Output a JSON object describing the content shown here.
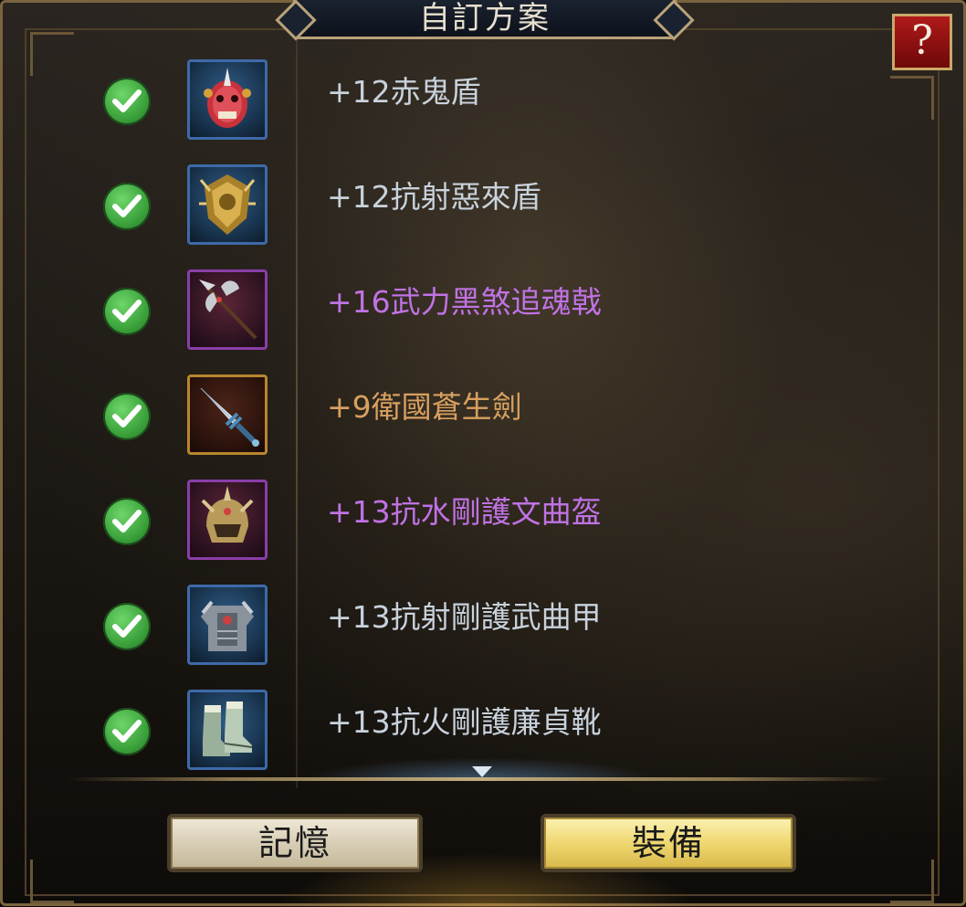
{
  "title": "自訂方案",
  "help_label": "?",
  "items": [
    {
      "name": "+12赤鬼盾",
      "icon": "red-demon-shield-icon",
      "rarity_color": "#3e6aa8",
      "text_color": "#c8d2dc"
    },
    {
      "name": "+12抗射惡來盾",
      "icon": "golden-shield-icon",
      "rarity_color": "#3e6aa8",
      "text_color": "#c8d2dc"
    },
    {
      "name": "+16武力黑煞追魂戟",
      "icon": "halberd-icon",
      "rarity_color": "#8a3ea8",
      "text_color": "#c072e4"
    },
    {
      "name": "+9衛國蒼生劍",
      "icon": "sword-icon",
      "rarity_color": "#b8862e",
      "text_color": "#d8a060"
    },
    {
      "name": "+13抗水剛護文曲盔",
      "icon": "helmet-icon",
      "rarity_color": "#8a3ea8",
      "text_color": "#c072e4"
    },
    {
      "name": "+13抗射剛護武曲甲",
      "icon": "armor-icon",
      "rarity_color": "#3e6aa8",
      "text_color": "#c8d2dc"
    },
    {
      "name": "+13抗火剛護廉貞靴",
      "icon": "boots-icon",
      "rarity_color": "#3e6aa8",
      "text_color": "#c8d2dc"
    }
  ],
  "buttons": {
    "memory_label": "記憶",
    "equip_label": "裝備"
  }
}
